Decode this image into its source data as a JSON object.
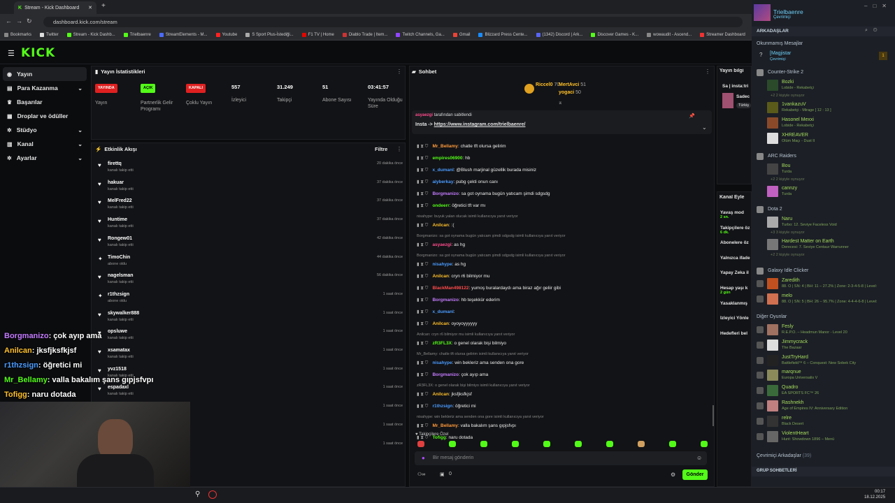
{
  "browser": {
    "tab_title": "Stream - Kick Dashboard",
    "url": "dashboard.kick.com/stream",
    "bookmarks": [
      {
        "label": "Bookmarks",
        "color": "#888"
      },
      {
        "label": "Twitter",
        "color": "#ddd"
      },
      {
        "label": "Stream - Kick Dashb...",
        "color": "#53fc18"
      },
      {
        "label": "Trielbaenre",
        "color": "#53fc18"
      },
      {
        "label": "StreamElements - M...",
        "color": "#4b6bff"
      },
      {
        "label": "Youtube",
        "color": "#ff2222"
      },
      {
        "label": "S Sport Plus-İstediği...",
        "color": "#aaa"
      },
      {
        "label": "F1 TV | Home",
        "color": "#e10600"
      },
      {
        "label": "Diablo Trade | Item...",
        "color": "#c33"
      },
      {
        "label": "Twitch Channels, Ga...",
        "color": "#9146ff"
      },
      {
        "label": "Gmail",
        "color": "#ea4335"
      },
      {
        "label": "Blizzard Press Cente...",
        "color": "#1a8cff"
      },
      {
        "label": "(1342) Discord | Ark...",
        "color": "#5865f2"
      },
      {
        "label": "Discover Games - K...",
        "color": "#53fc18"
      },
      {
        "label": "wowaudit - Ascend...",
        "color": "#888"
      },
      {
        "label": "Streamer Dashboard",
        "color": "#e33"
      }
    ]
  },
  "kick": {
    "logo": "KICK",
    "sidebar": [
      {
        "label": "Yayın",
        "icon": "broadcast",
        "active": true,
        "chev": ""
      },
      {
        "label": "Para Kazanma",
        "icon": "wallet",
        "chev": "⌄"
      },
      {
        "label": "Başarılar",
        "icon": "trophy",
        "chev": ""
      },
      {
        "label": "Droplar ve ödüller",
        "icon": "gift",
        "chev": ""
      },
      {
        "label": "Stüdyo",
        "icon": "gear",
        "chev": "⌄"
      },
      {
        "label": "Kanal",
        "icon": "doc",
        "chev": "⌄"
      },
      {
        "label": "Ayarlar",
        "icon": "gear",
        "chev": "⌄"
      }
    ],
    "stats_title": "Yayın İstatistikleri",
    "stats": [
      {
        "value": "YAYINDA",
        "label": "Yayın",
        "badge": "#e02020"
      },
      {
        "value": "AÇIK",
        "label": "Partnerlik Gelir Programı",
        "badge": "#53fc18"
      },
      {
        "value": "KAPALI",
        "label": "Çoklu Yayın",
        "badge": "#e02020"
      },
      {
        "value": "557",
        "label": "İzleyici"
      },
      {
        "value": "31.249",
        "label": "Takipçi"
      },
      {
        "value": "51",
        "label": "Abone Sayısı"
      },
      {
        "value": "03:41:57",
        "label": "Yayında Olduğu Süre"
      }
    ],
    "activity_title": "Etkinlik Akışı",
    "filter": "Filtre",
    "activity": [
      {
        "name": "firettq",
        "sub": "kanalı takip etti",
        "time": "20 dakika önce",
        "icon": "♥"
      },
      {
        "name": "hakuar",
        "sub": "kanalı takip etti",
        "time": "37 dakika önce",
        "icon": "♥"
      },
      {
        "name": "MelFred22",
        "sub": "kanalı takip etti",
        "time": "37 dakika önce",
        "icon": "♥"
      },
      {
        "name": "Huntime",
        "sub": "kanalı takip etti",
        "time": "37 dakika önce",
        "icon": "♥"
      },
      {
        "name": "Rongew01",
        "sub": "kanalı takip etti",
        "time": "42 dakika önce",
        "icon": "♥"
      },
      {
        "name": "TimoChin",
        "sub": "abone oldu",
        "time": "44 dakika önce",
        "icon": "✦"
      },
      {
        "name": "nagelsman",
        "sub": "kanalı takip etti",
        "time": "56 dakika önce",
        "icon": "♥"
      },
      {
        "name": "r1thzsign",
        "sub": "abone oldu",
        "time": "1 saat önce",
        "icon": "✦"
      },
      {
        "name": "skywalker888",
        "sub": "kanalı takip etti",
        "time": "1 saat önce",
        "icon": "♥"
      },
      {
        "name": "opsluwe",
        "sub": "kanalı takip etti",
        "time": "1 saat önce",
        "icon": "♥"
      },
      {
        "name": "xsamatax",
        "sub": "kanalı takip etti",
        "time": "1 saat önce",
        "icon": "♥"
      },
      {
        "name": "yvz1518",
        "sub": "kanalı takip etti",
        "time": "1 saat önce",
        "icon": "♥"
      },
      {
        "name": "espadaxl",
        "sub": "kanalı takip etti",
        "time": "1 saat önce",
        "icon": "♥"
      },
      {
        "name": "",
        "sub": "",
        "time": "1 saat önce",
        "icon": ""
      },
      {
        "name": "",
        "sub": "",
        "time": "1 saat önce",
        "icon": ""
      },
      {
        "name": "",
        "sub": "",
        "time": "1 saat önce",
        "icon": ""
      }
    ],
    "chat_title": "Sohbet",
    "top_gifters": [
      {
        "name": "Riccel0",
        "value": "70"
      },
      {
        "name": "MertAvci",
        "value": "51"
      },
      {
        "name": "yogaci",
        "value": "50"
      }
    ],
    "pinned": {
      "by": "asyaezgi",
      "suffix": "tarafından sabitlendi",
      "text": "Insta ->",
      "link": "https://www.instagram.com/trielbaenre/"
    },
    "chat": [
      {
        "t": "m",
        "user": "Mr_Bellamy",
        "color": "#ff9a3c",
        "text": "chatle tft olursa gelirim"
      },
      {
        "t": "m",
        "user": "empires06900",
        "color": "#53fc18",
        "text": "hb"
      },
      {
        "t": "m",
        "user": "x_dumanl",
        "color": "#4b9bff",
        "text": "@Blush marjinal güzellik burada misiniz"
      },
      {
        "t": "m",
        "user": "alyberkay",
        "color": "#4b9bff",
        "text": "pubg çekti onun canı"
      },
      {
        "t": "m",
        "user": "Borgmanizo",
        "color": "#c47bff",
        "text": "sa got oynama bugün yatıcam şimdi sdgsdg"
      },
      {
        "t": "m",
        "user": "ondeerr",
        "color": "#53fc18",
        "text": "öğretici tft var mı"
      },
      {
        "t": "r",
        "text": "nisahype: buyuk yalan olucak isimli kullanıcıya yanıt veriyor"
      },
      {
        "t": "m",
        "user": "Anilcan",
        "color": "#ffc02a",
        "text": ":("
      },
      {
        "t": "r",
        "text": "Borgmanizo: sa got oynama bugün yatıcam şimdi sdgsdg isimli kullanıcıya yanıt veriyor"
      },
      {
        "t": "m",
        "user": "asyaezgi",
        "color": "#ff4b8c",
        "text": "as hg"
      },
      {
        "t": "r",
        "text": "Borgmanizo: sa got oynama bugün yatıcam şimdi sdgsdg isimli kullanıcıya yanıt veriyor"
      },
      {
        "t": "m",
        "user": "nisahype",
        "color": "#4b9bff",
        "text": "as hg"
      },
      {
        "t": "m",
        "user": "Anilcan",
        "color": "#ffc02a",
        "text": "cryn r6 bilmiyor mu"
      },
      {
        "t": "m",
        "user": "BlackMan498122",
        "color": "#ff4b4b",
        "text": "yumoş buralardaydı ama biraz ağır geliir gibi"
      },
      {
        "t": "m",
        "user": "Borgmanizo",
        "color": "#c47bff",
        "text": "hb teşekkür ederim"
      },
      {
        "t": "m",
        "user": "x_dumanl",
        "color": "#4b9bff",
        "text": ""
      },
      {
        "t": "m",
        "user": "Anilcan",
        "color": "#ffc02a",
        "text": "oyoyoyyyyyy"
      },
      {
        "t": "r",
        "text": "Anilcan: cryn r6 bilmiyor mu isimli kullanıcıya yanıt veriyor"
      },
      {
        "t": "m",
        "user": "zR3FL3X",
        "color": "#53fc18",
        "text": "o genel olarak bişi bilmiyo"
      },
      {
        "t": "r",
        "text": "Mr_Bellamy: chatle tft olursa gelirim isimli kullanıcıya yanıt veriyor"
      },
      {
        "t": "m",
        "user": "nisahype",
        "color": "#4b9bff",
        "text": "win bekleriz ama senden ona gore"
      },
      {
        "t": "m",
        "user": "Borgmanizo",
        "color": "#c47bff",
        "text": "çok ayıp ama"
      },
      {
        "t": "r",
        "text": "zR3FL3X: o genel olarak bişi bilmiyo isimli kullanıcıya yanıt veriyor"
      },
      {
        "t": "m",
        "user": "Anilcan",
        "color": "#ffc02a",
        "text": "jksfjksfkjsf"
      },
      {
        "t": "m",
        "user": "r1thzsign",
        "color": "#4b9bff",
        "text": "öğretici mi"
      },
      {
        "t": "r",
        "text": "nisahype: win bekleriz ama senden ona gore isimli kullanıcıya yanıt veriyor"
      },
      {
        "t": "m",
        "user": "Mr_Bellamy",
        "color": "#ff9a3c",
        "text": "valla bakalım şans gıpjsfvpı"
      },
      {
        "t": "m",
        "user": "Tofigg",
        "color": "#53fc18",
        "text": "naru dotada"
      }
    ],
    "followers_only": "Takipçilere Özel",
    "chat_placeholder": "Bir mesaj gönderin",
    "send": "Gönder",
    "count": "0",
    "right_panel": {
      "title": "Yayın bilgi",
      "line1": "Sa | insta:tri",
      "line2": "Sadec",
      "tag": "Türkiş"
    },
    "chan_events": {
      "title": "Kanal Eyle",
      "items": [
        {
          "label": "Yavaş mod",
          "sub": "2 sn."
        },
        {
          "label": "Takipçilere öz",
          "sub": "6 dk."
        },
        {
          "label": "Abonelere öz",
          "sub": ""
        },
        {
          "label": "Yalnızca ifade",
          "sub": ""
        },
        {
          "label": "Yapay Zeka il",
          "sub": ""
        },
        {
          "label": "Hesap yaşı k",
          "sub": "2 gün"
        },
        {
          "label": "Yasaklanmış",
          "sub": ""
        },
        {
          "label": "İzleyici Yönle",
          "sub": ""
        },
        {
          "label": "Hedefleri bel",
          "sub": ""
        }
      ]
    }
  },
  "overlay": [
    {
      "user": "Borgmanizo",
      "color": "#c47bff",
      "text": ": çok ayıp ama"
    },
    {
      "user": "Anilcan",
      "color": "#ffc02a",
      "text": ": jksfjksfkjsf"
    },
    {
      "user": "r1thzsign",
      "color": "#4b9bff",
      "text": ": öğretici mi"
    },
    {
      "user": "Mr_Bellamy",
      "color": "#53fc18",
      "text": ": valla bakalım şans gıpjsfvpı"
    },
    {
      "user": "Tofigg",
      "color": "#ffc02a",
      "text": ": naru dotada"
    }
  ],
  "steam": {
    "user": "Trielbaenre",
    "status": "Çevrimiçi",
    "friends_header": "ARKADAŞLAR",
    "unread": "Okunmamış Mesajlar",
    "unread_item": {
      "name": "[Magjistar",
      "status": "Çevrimiçi",
      "count": "1"
    },
    "groups": [
      {
        "game": "Counter-Strike 2",
        "friends": [
          {
            "name": "Bozki",
            "status": "Lobide - Rekabetçi",
            "color": "#2a4a2a"
          },
          {
            "more": "+2  2 kişiyle oynuyor"
          },
          {
            "name": "1vankazuV",
            "status": "Rekabetçi - Mirage [ 12 : 13 ]",
            "color": "#5a5a1a"
          },
          {
            "name": "Hasonel Mexxi",
            "status": "Lobide - Rekabetçi",
            "color": "#8a4a2a"
          },
          {
            "name": "XHREAVER",
            "status": "Ölüm Maçı - Dust II",
            "color": "#ddd"
          }
        ]
      },
      {
        "game": "ARC Raiders",
        "friends": [
          {
            "name": "Bou",
            "status": "Turda",
            "color": "#444"
          },
          {
            "more": "+2  2 kişiyle oynuyor"
          },
          {
            "name": "cannzy",
            "status": "Turda",
            "color": "#c060c0"
          }
        ]
      },
      {
        "game": "Dota 2",
        "friends": [
          {
            "name": "Naru",
            "status": "Turbo: 12. Seviye Faceless Void",
            "color": "#aaa"
          },
          {
            "more": "+3  3 kişiyle oynuyor"
          },
          {
            "name": "Hardest Matter on Earth",
            "status": "Derecesi: 7. Seviye Centaur Warrunner",
            "color": "#777"
          },
          {
            "more": "+2  2 kişiyle oynuyor"
          }
        ]
      },
      {
        "game": "Galaxy Idle Clicker",
        "friends": [
          {
            "name": "Zaredith",
            "status": "88. O | SN: 4 | BH: 11 – 27.2% | Zone: 2-3-4-5-8 | Level:",
            "color": "#c05020"
          },
          {
            "name": "melo",
            "status": "88. O | SN: 5 | BH: 26 – 95.7% | Zone: 4-4-4-6-8 | Level:",
            "color": "#d07050"
          }
        ]
      },
      {
        "game": "Diğer Oyunlar",
        "friends": [
          {
            "name": "Fesly",
            "status": "R.E.P.O. – Headmun Manor - Level 20",
            "color": "#a07060"
          },
          {
            "name": "Jimmycrack",
            "status": "The Bazaar",
            "color": "#ddd"
          },
          {
            "name": "JustTryHard",
            "status": "Battlefield™ 6 – Conquest: New Sobek City",
            "color": "#222"
          },
          {
            "name": "marqnue",
            "status": "Europa Universalis V",
            "color": "#8a8a5a"
          },
          {
            "name": "Quadro",
            "status": "EA SPORTS FC™ 26",
            "color": "#3a6a3a"
          },
          {
            "name": "Rashnekh",
            "status": "Age of Empires IV: Anniversary Edition",
            "color": "#c08080"
          },
          {
            "name": "relre",
            "status": "Black Desert",
            "color": "#333"
          },
          {
            "name": "ViolentHeart",
            "status": "Hunt: Showdown 1896 – Menü",
            "color": "#666"
          }
        ]
      }
    ],
    "online_friends": "Çevrimiçi Arkadaşlar",
    "online_count": "(39)",
    "group_chats": "GRUP SOHBETLERİ"
  },
  "clock": {
    "time": "00:17",
    "date": "18.12.2025"
  }
}
